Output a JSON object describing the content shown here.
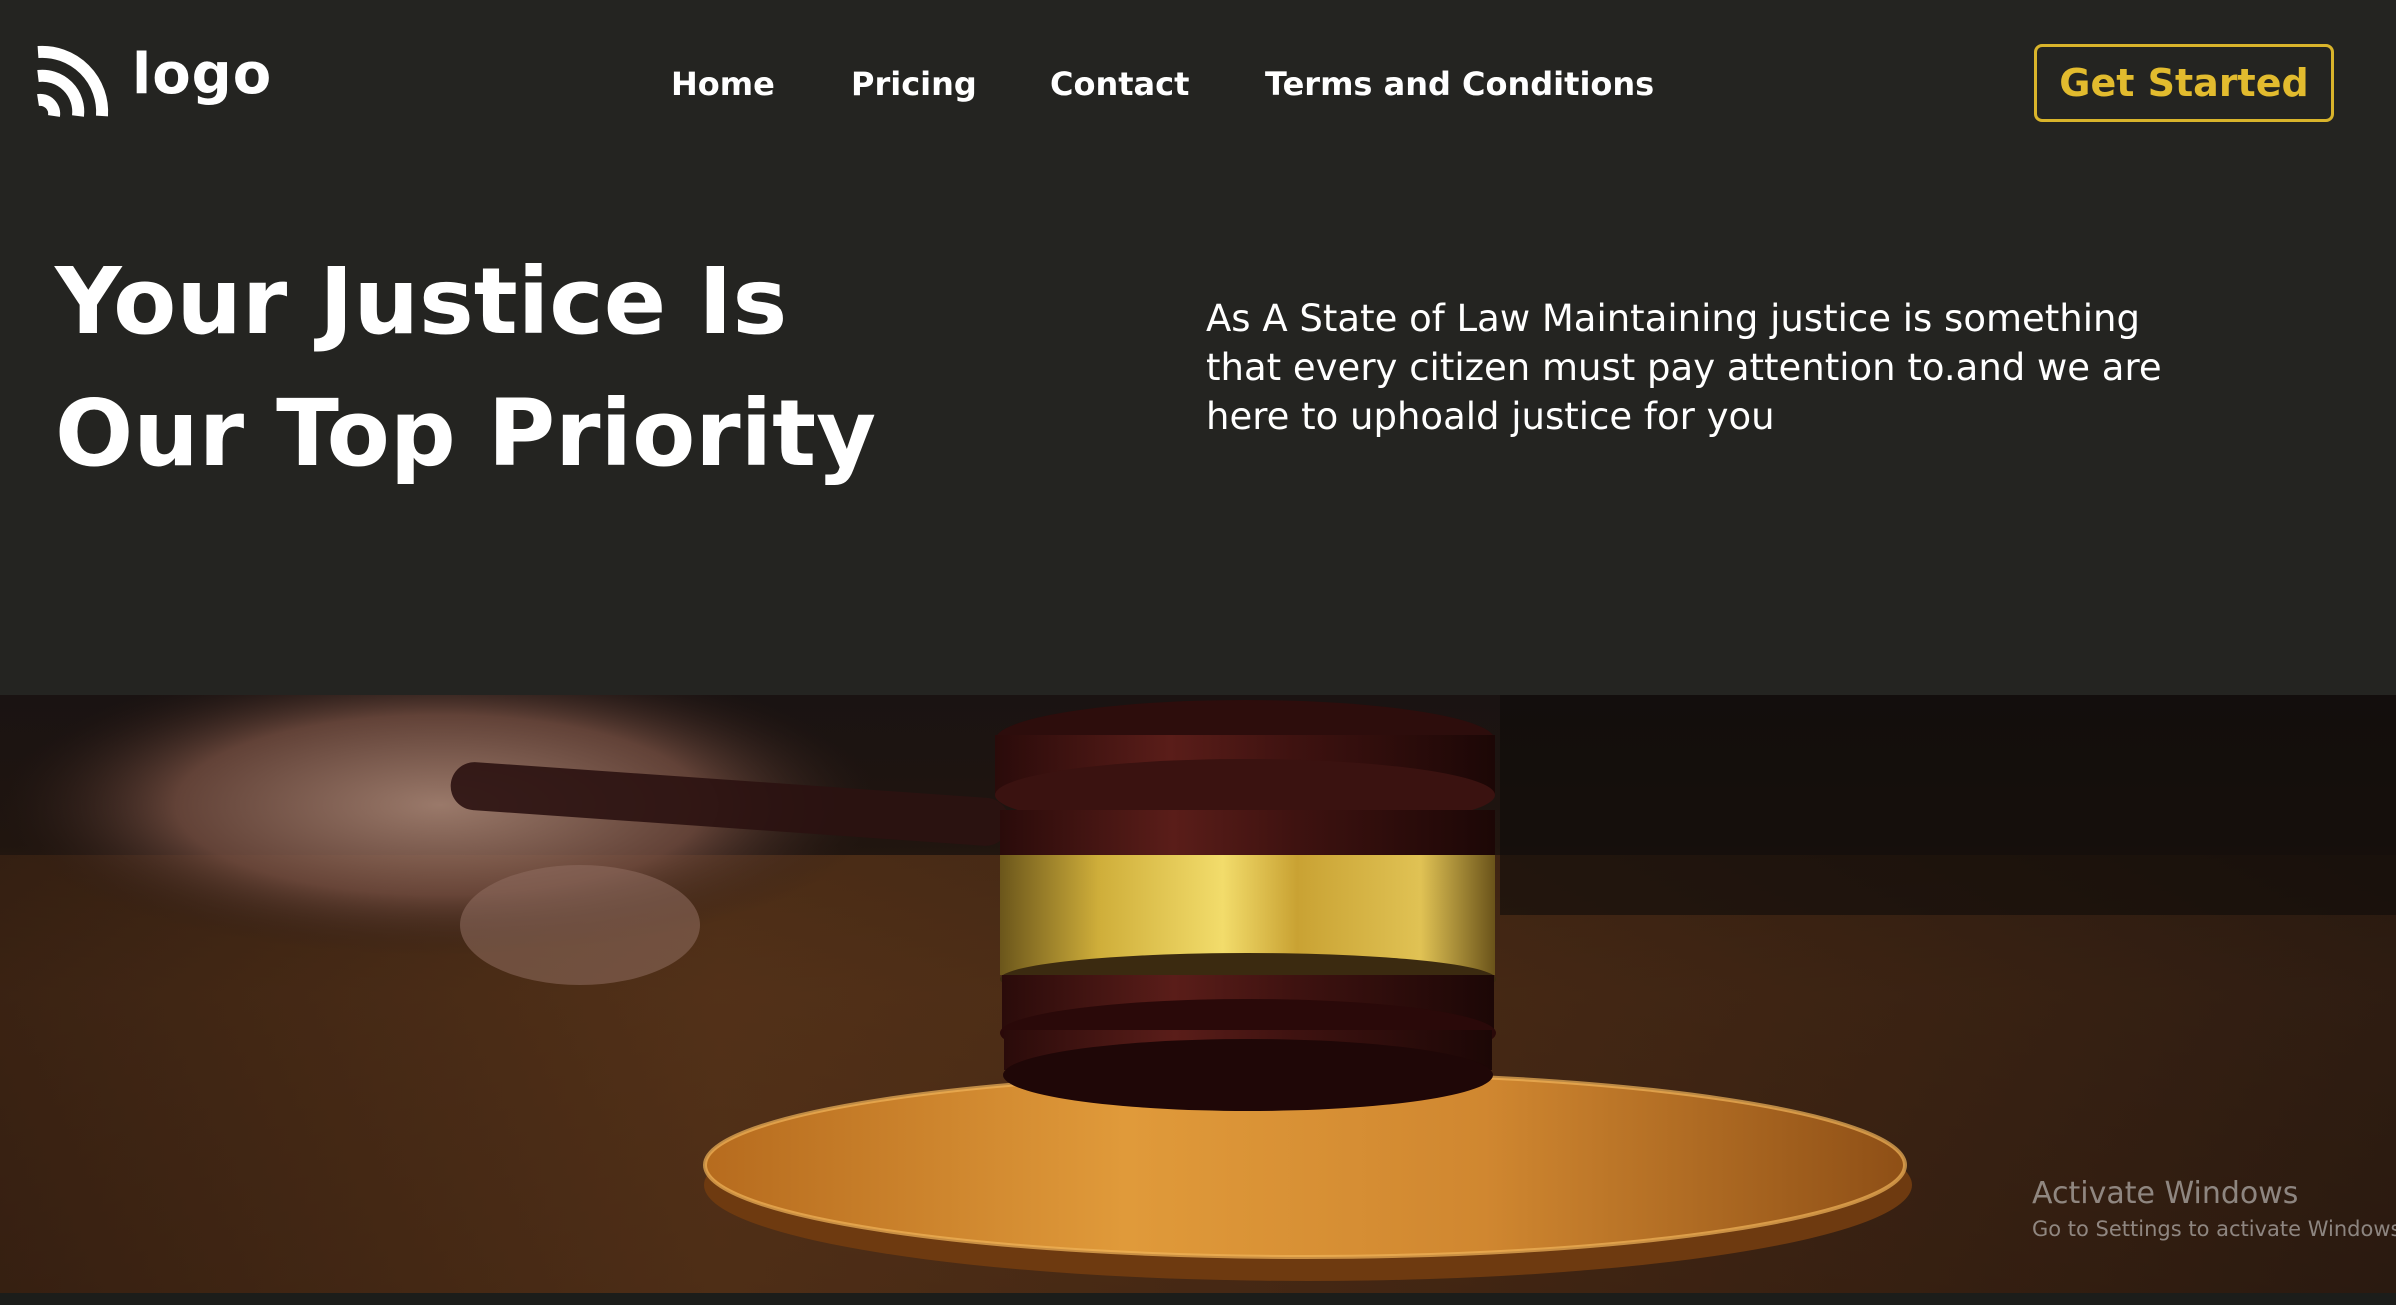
{
  "header": {
    "logo_text": "logo",
    "logo_icon": "wifi-arcs-icon",
    "nav": [
      {
        "label": "Home"
      },
      {
        "label": "Pricing"
      },
      {
        "label": "Contact"
      },
      {
        "label": "Terms and Conditions"
      }
    ],
    "cta_label": "Get Started"
  },
  "hero": {
    "title_line1": "Your Justice Is",
    "title_line2": "Our Top Priority",
    "description": "As A State of Law Maintaining justice is something that every citizen must pay attention to.and we are here to uphoald justice for you",
    "image": "gavel-on-sound-block-photo"
  },
  "os_overlay": {
    "title": "Activate Windows",
    "subtitle": "Go to Settings to activate Windows."
  },
  "colors": {
    "background": "#242421",
    "accent": "#e2bb2e",
    "text": "#ffffff"
  }
}
